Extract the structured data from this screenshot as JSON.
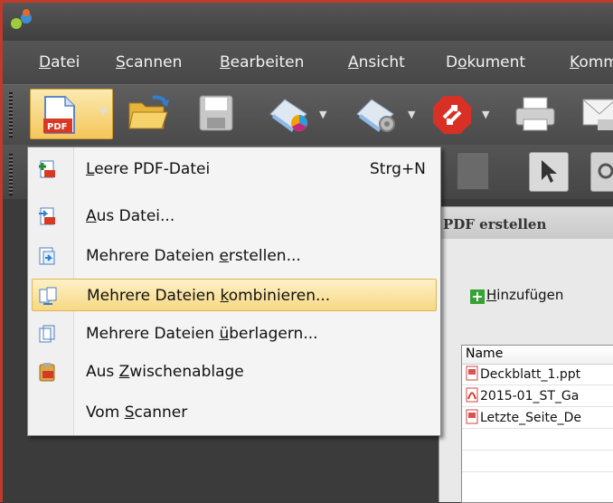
{
  "menubar": {
    "items": [
      {
        "pre": "",
        "u": "D",
        "post": "atei"
      },
      {
        "pre": "",
        "u": "S",
        "post": "cannen"
      },
      {
        "pre": "",
        "u": "B",
        "post": "earbeiten"
      },
      {
        "pre": "",
        "u": "A",
        "post": "nsicht"
      },
      {
        "pre": "D",
        "u": "o",
        "post": "kument"
      },
      {
        "pre": "",
        "u": "K",
        "post": "omm"
      }
    ]
  },
  "toolbar": {
    "new_pdf_icon_label": "PDF"
  },
  "dropdown": {
    "items": [
      {
        "pre": "",
        "u": "L",
        "post": "eere PDF-Datei",
        "shortcut": "Strg+N",
        "icon": "new-pdf-icon"
      },
      {
        "pre": "",
        "u": "A",
        "post": "us Datei...",
        "shortcut": "",
        "icon": "pdf-from-file-icon"
      },
      {
        "pre": "Mehrere Dateien ",
        "u": "e",
        "post": "rstellen...",
        "shortcut": "",
        "icon": "create-multiple-icon"
      },
      {
        "pre": "Mehrere Dateien ",
        "u": "k",
        "post": "ombinieren...",
        "shortcut": "",
        "icon": "combine-files-icon",
        "highlighted": true
      },
      {
        "pre": "Mehrere Dateien ",
        "u": "ü",
        "post": "berlagern...",
        "shortcut": "",
        "icon": "overlay-files-icon"
      },
      {
        "pre": "Aus ",
        "u": "Z",
        "post": "wischenablage",
        "shortcut": "",
        "icon": "clipboard-icon"
      },
      {
        "pre": "Vom ",
        "u": "S",
        "post": "canner",
        "shortcut": "",
        "icon": ""
      }
    ]
  },
  "dialog": {
    "title": "PDF erstellen",
    "add_button": {
      "pre": "",
      "u": "H",
      "post": "inzufügen"
    },
    "column_name": "Name",
    "files": [
      {
        "name": "Deckblatt_1.ppt",
        "type": "ppt"
      },
      {
        "name": "2015-01_ST_Ga",
        "type": "pdf"
      },
      {
        "name": "Letzte_Seite_De",
        "type": "ppt"
      }
    ]
  },
  "colors": {
    "accent_highlight": "#f7d883",
    "frame_red": "#c0392b",
    "pdf_red": "#d63a25"
  }
}
